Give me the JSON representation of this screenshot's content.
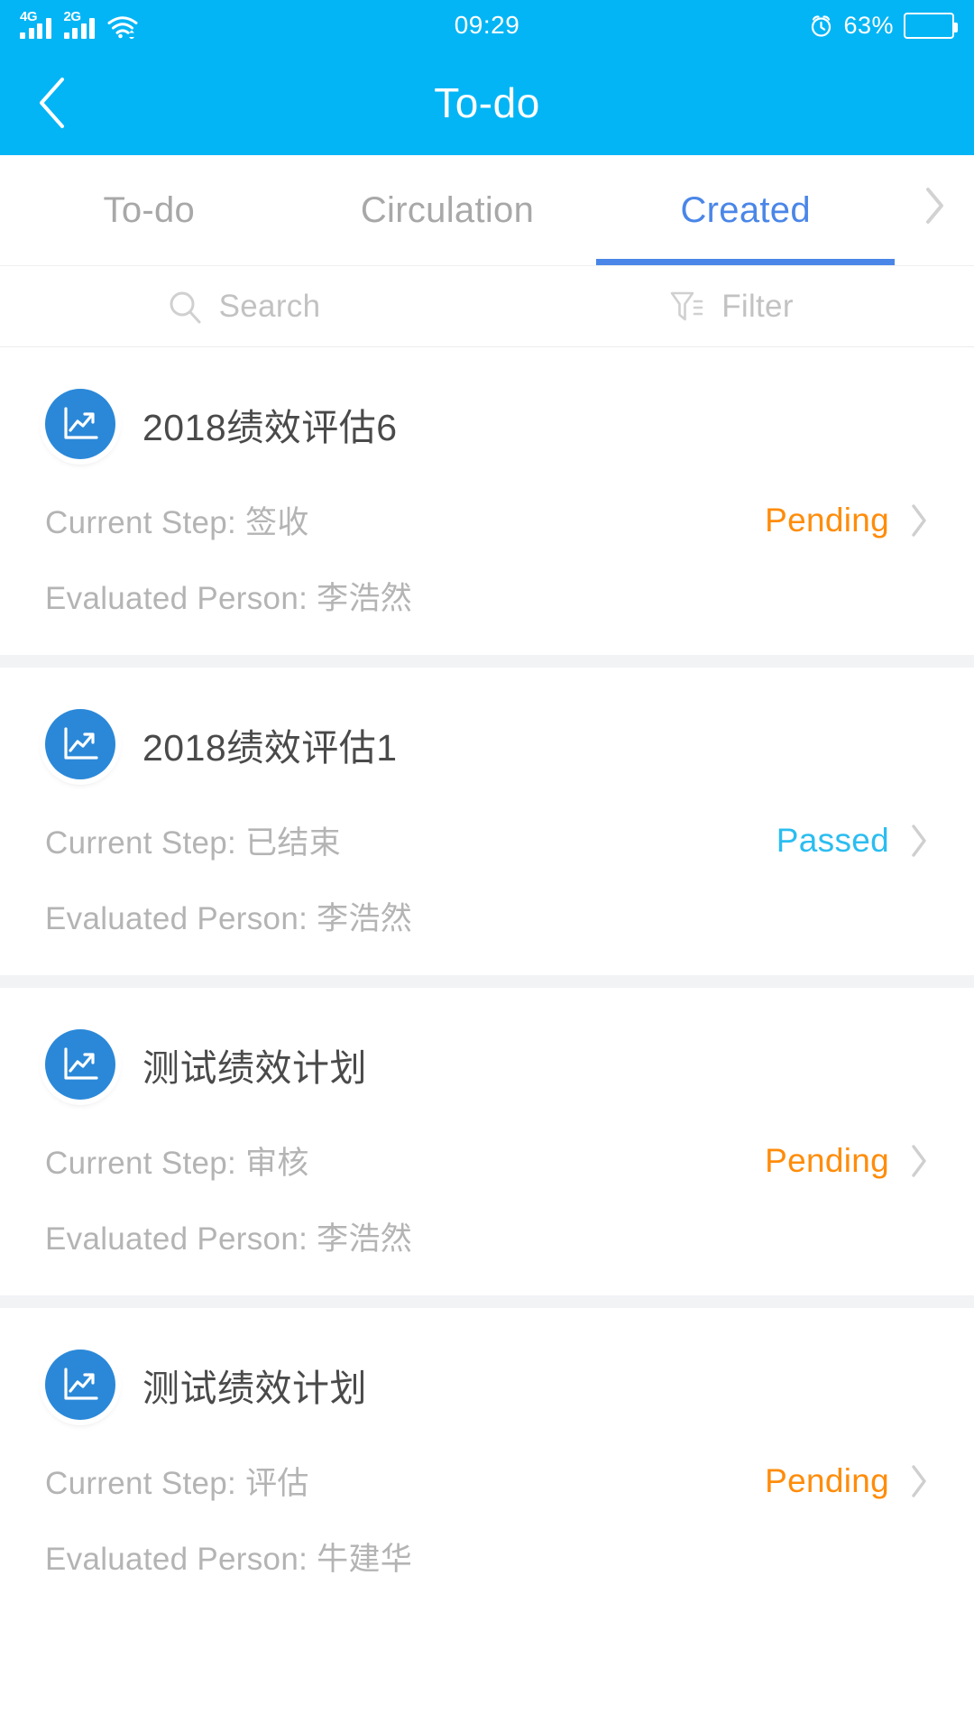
{
  "statusbar": {
    "signal_1_label": "4G",
    "signal_2_label": "2G",
    "wifi_icon": "wifi-icon",
    "time": "09:29",
    "alarm_icon": "alarm-clock-icon",
    "battery_percent": "63%",
    "battery_icon": "battery-icon"
  },
  "header": {
    "back_icon": "chevron-left-icon",
    "title": "To-do"
  },
  "tabs": {
    "items": [
      {
        "label": "To-do",
        "active": false
      },
      {
        "label": "Circulation",
        "active": false
      },
      {
        "label": "Created",
        "active": true
      }
    ],
    "more_icon": "chevron-right-icon",
    "active_color": "#4a86e8",
    "inactive_color": "#a8a8a8"
  },
  "toolbar": {
    "search_label": "Search",
    "search_icon": "search-icon",
    "filter_label": "Filter",
    "filter_icon": "filter-icon"
  },
  "labels": {
    "current_step": "Current Step:",
    "evaluated_person": "Evaluated Person:",
    "item_icon": "chart-trend-icon",
    "row_chevron_icon": "chevron-right-icon"
  },
  "colors": {
    "brand": "#03B5F5",
    "accent": "#4a86e8",
    "pending": "#FF8C0A",
    "passed": "#2BBDF0",
    "avatar": "#2b88d8"
  },
  "list": [
    {
      "title": "2018绩效评估6",
      "current_step": "签收",
      "evaluated_person": "李浩然",
      "status": "Pending",
      "status_kind": "pending"
    },
    {
      "title": "2018绩效评估1",
      "current_step": "已结束",
      "evaluated_person": "李浩然",
      "status": "Passed",
      "status_kind": "passed"
    },
    {
      "title": "测试绩效计划",
      "current_step": "审核",
      "evaluated_person": "李浩然",
      "status": "Pending",
      "status_kind": "pending"
    },
    {
      "title": "测试绩效计划",
      "current_step": "评估",
      "evaluated_person": "牛建华",
      "status": "Pending",
      "status_kind": "pending"
    }
  ]
}
